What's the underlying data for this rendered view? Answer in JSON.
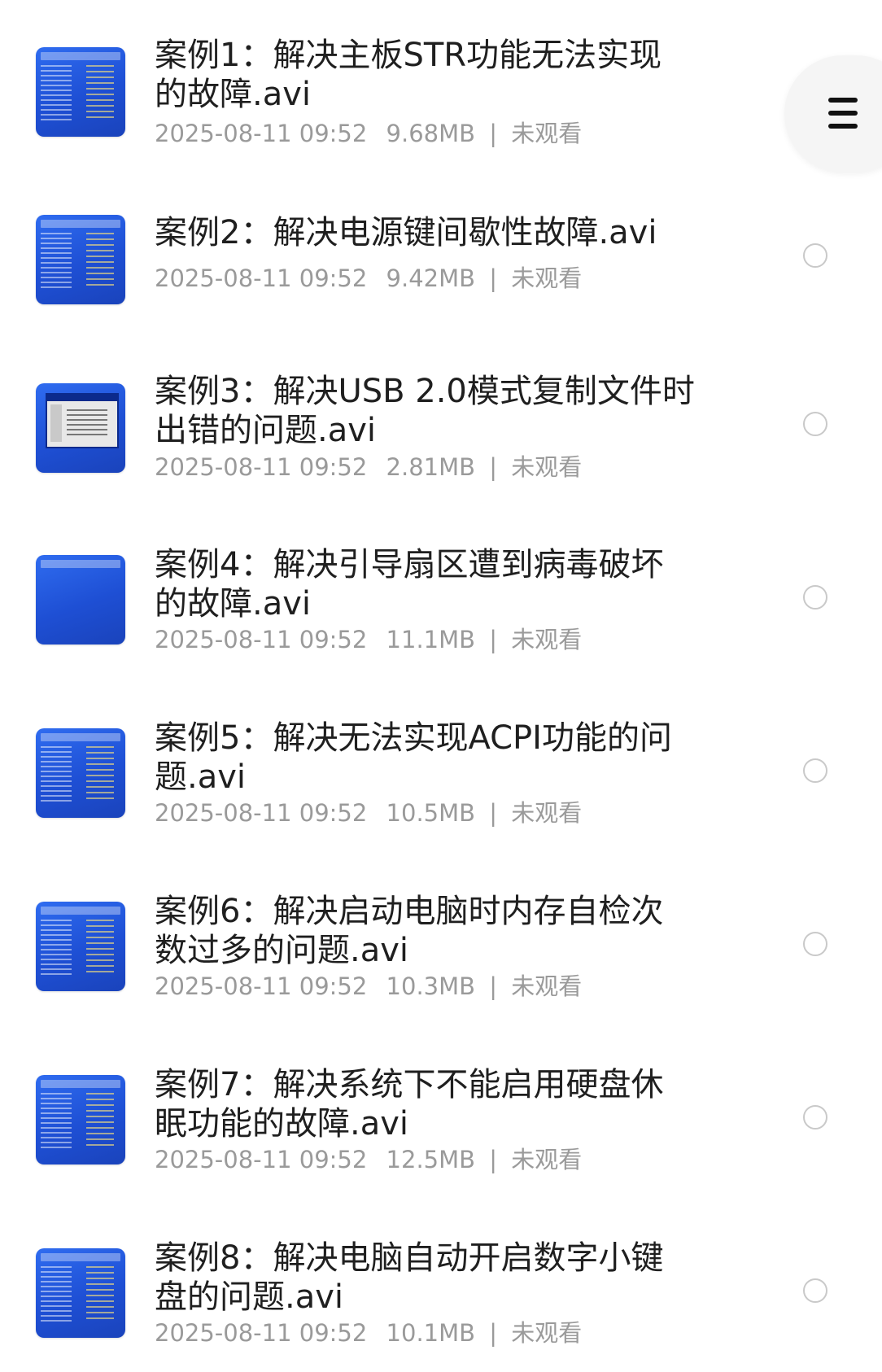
{
  "items": [
    {
      "title": "案例1：解决主板STR功能无法实现\n的故障.avi",
      "date": "2025-08-11 09:52",
      "size": "9.68MB",
      "separator": "|",
      "status": "未观看"
    },
    {
      "title": "案例2：解决电源键间歇性故障.avi",
      "date": "2025-08-11 09:52",
      "size": "9.42MB",
      "separator": "|",
      "status": "未观看"
    },
    {
      "title": "案例3：解决USB 2.0模式复制文件时\n出错的问题.avi",
      "date": "2025-08-11 09:52",
      "size": "2.81MB",
      "separator": "|",
      "status": "未观看"
    },
    {
      "title": "案例4：解决引导扇区遭到病毒破坏\n的故障.avi",
      "date": "2025-08-11 09:52",
      "size": "11.1MB",
      "separator": "|",
      "status": "未观看"
    },
    {
      "title": "案例5：解决无法实现ACPI功能的问\n题.avi",
      "date": "2025-08-11 09:52",
      "size": "10.5MB",
      "separator": "|",
      "status": "未观看"
    },
    {
      "title": "案例6：解决启动电脑时内存自检次\n数过多的问题.avi",
      "date": "2025-08-11 09:52",
      "size": "10.3MB",
      "separator": "|",
      "status": "未观看"
    },
    {
      "title": "案例7：解决系统下不能启用硬盘休\n眠功能的故障.avi",
      "date": "2025-08-11 09:52",
      "size": "12.5MB",
      "separator": "|",
      "status": "未观看"
    },
    {
      "title": "案例8：解决电脑自动开启数字小键\n盘的问题.avi",
      "date": "2025-08-11 09:52",
      "size": "10.1MB",
      "separator": "|",
      "status": "未观看"
    }
  ],
  "menu_icon": "hamburger-menu-icon",
  "colors": {
    "thumbnail_blue": "#2f6cf0",
    "title_text": "#1f1f1f",
    "meta_text": "#9a9a9a",
    "radio_border": "#c9c9c9",
    "fab_background": "#f5f5f5"
  }
}
